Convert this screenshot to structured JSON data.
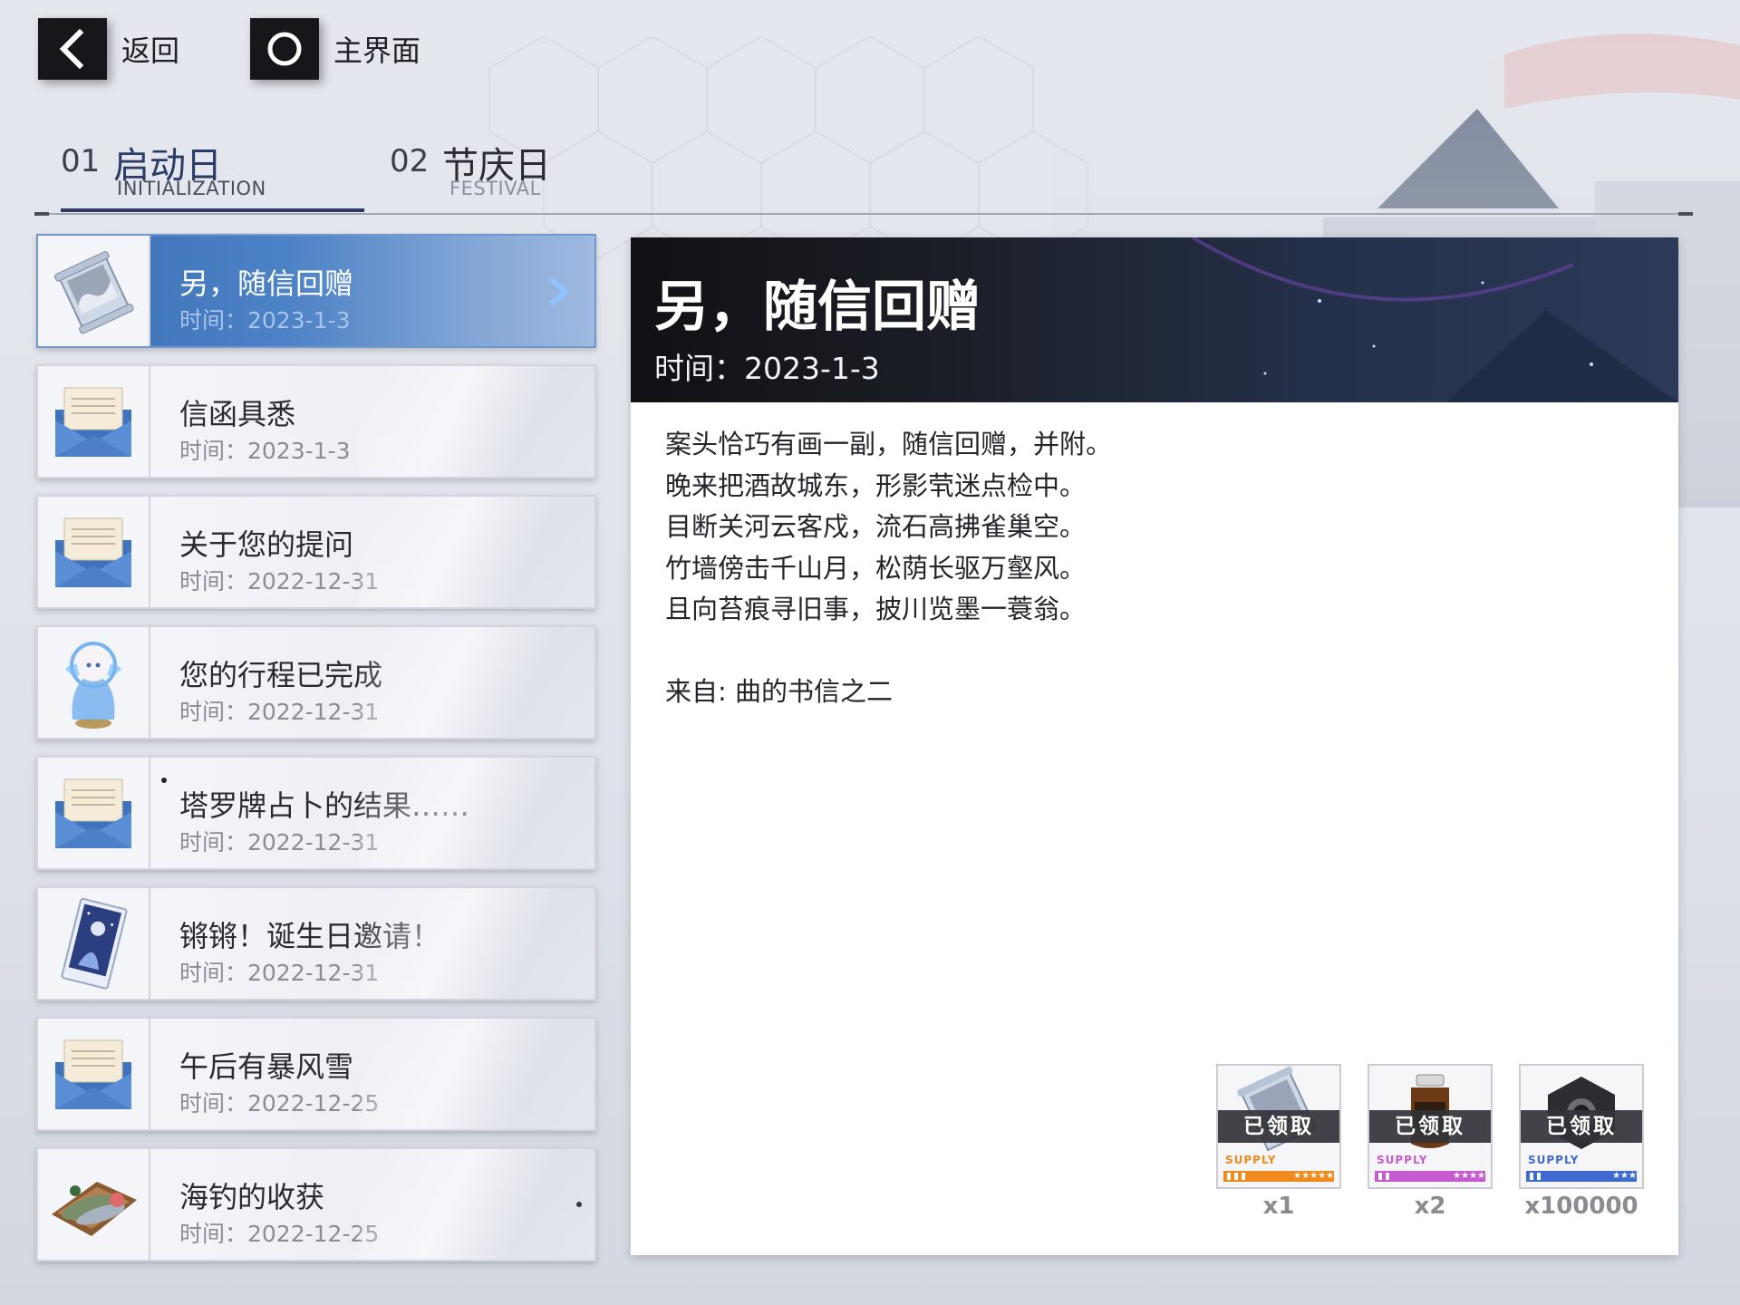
{
  "nav": {
    "back_label": "返回",
    "home_label": "主界面"
  },
  "tabs": [
    {
      "num": "01",
      "label": "启动日",
      "sub": "INITIALIZATION",
      "active": true
    },
    {
      "num": "02",
      "label": "节庆日",
      "sub": "FESTIVAL",
      "active": false
    }
  ],
  "mails": [
    {
      "title": "另，随信回赠",
      "time": "时间：2023-1-3",
      "icon": "scroll-gift-icon",
      "active": true
    },
    {
      "title": "信函具悉",
      "time": "时间：2023-1-3",
      "icon": "envelope-icon"
    },
    {
      "title": "关于您的提问",
      "time": "时间：2022-12-31",
      "icon": "envelope-icon"
    },
    {
      "title": "您的行程已完成",
      "time": "时间：2022-12-31",
      "icon": "character-figurine-icon"
    },
    {
      "title": "塔罗牌占卜的结果……",
      "time": "时间：2022-12-31",
      "icon": "envelope-icon"
    },
    {
      "title": "锵锵！诞生日邀请！",
      "time": "时间：2022-12-31",
      "icon": "tarot-card-icon"
    },
    {
      "title": "午后有暴风雪",
      "time": "时间：2022-12-25",
      "icon": "envelope-icon"
    },
    {
      "title": "海钓的收获",
      "time": "时间：2022-12-25",
      "icon": "fish-platter-icon"
    }
  ],
  "detail": {
    "title": "另，随信回赠",
    "time": "时间：2023-1-3",
    "body_lines": [
      "案头恰巧有画一副，随信回赠，并附。",
      "晚来把酒故城东，形影茕迷点检中。",
      "目断关河云客戍，流石高拂雀巢空。",
      "竹墙傍击千山月，松荫长驱万壑风。",
      "且向苔痕寻旧事，披川览墨一蓑翁。"
    ],
    "sender_label": "来自: ",
    "sender": "曲的书信之二"
  },
  "rewards": [
    {
      "claimed_label": "已领取",
      "supply_label": "SUPPLY",
      "stars": "★★★★★",
      "qty": "x1",
      "rarity_color": "#f08a1c",
      "icon": "scroll-gift-icon"
    },
    {
      "claimed_label": "已领取",
      "supply_label": "SUPPLY",
      "stars": "★★★★",
      "qty": "x2",
      "rarity_color": "#c65bcf",
      "icon": "jar-icon"
    },
    {
      "claimed_label": "已领取",
      "supply_label": "SUPPLY",
      "stars": "★★★",
      "qty": "x100000",
      "rarity_color": "#3f6ad0",
      "icon": "hex-nut-icon"
    }
  ],
  "colors": {
    "active_item": "#4c82c6",
    "panel_header": "#1b1e26"
  }
}
